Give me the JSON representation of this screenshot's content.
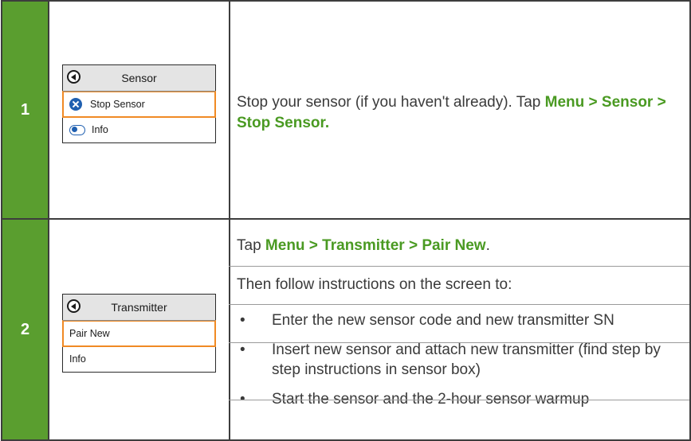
{
  "steps": [
    {
      "number": "1",
      "screen": {
        "title": "Sensor",
        "items": [
          {
            "label": "Stop Sensor",
            "icon": "stop-icon",
            "highlighted": true
          },
          {
            "label": "Info",
            "icon": "info-icon",
            "highlighted": false
          }
        ]
      },
      "text_plain": "Stop your sensor (if you haven't already). Tap ",
      "text_bold": "Menu > Sensor > Stop Sensor."
    },
    {
      "number": "2",
      "screen": {
        "title": "Transmitter",
        "items": [
          {
            "label": "Pair New",
            "highlighted": true
          },
          {
            "label": "Info",
            "highlighted": false
          }
        ]
      },
      "tap_prefix": "Tap ",
      "tap_bold": "Menu > Transmitter > Pair New",
      "tap_suffix": ".",
      "follow_text": "Then follow instructions on the screen to:",
      "bullets": [
        "Enter the new sensor code and new transmitter SN",
        "Insert new sensor and attach new transmitter (find step by step instructions in sensor box)",
        "Start the sensor and the 2-hour sensor warmup"
      ]
    }
  ],
  "colors": {
    "step_green": "#5a9e2f",
    "highlight_orange": "#f08a24",
    "icon_blue": "#1f5fb0",
    "bold_green": "#4a9a22"
  }
}
